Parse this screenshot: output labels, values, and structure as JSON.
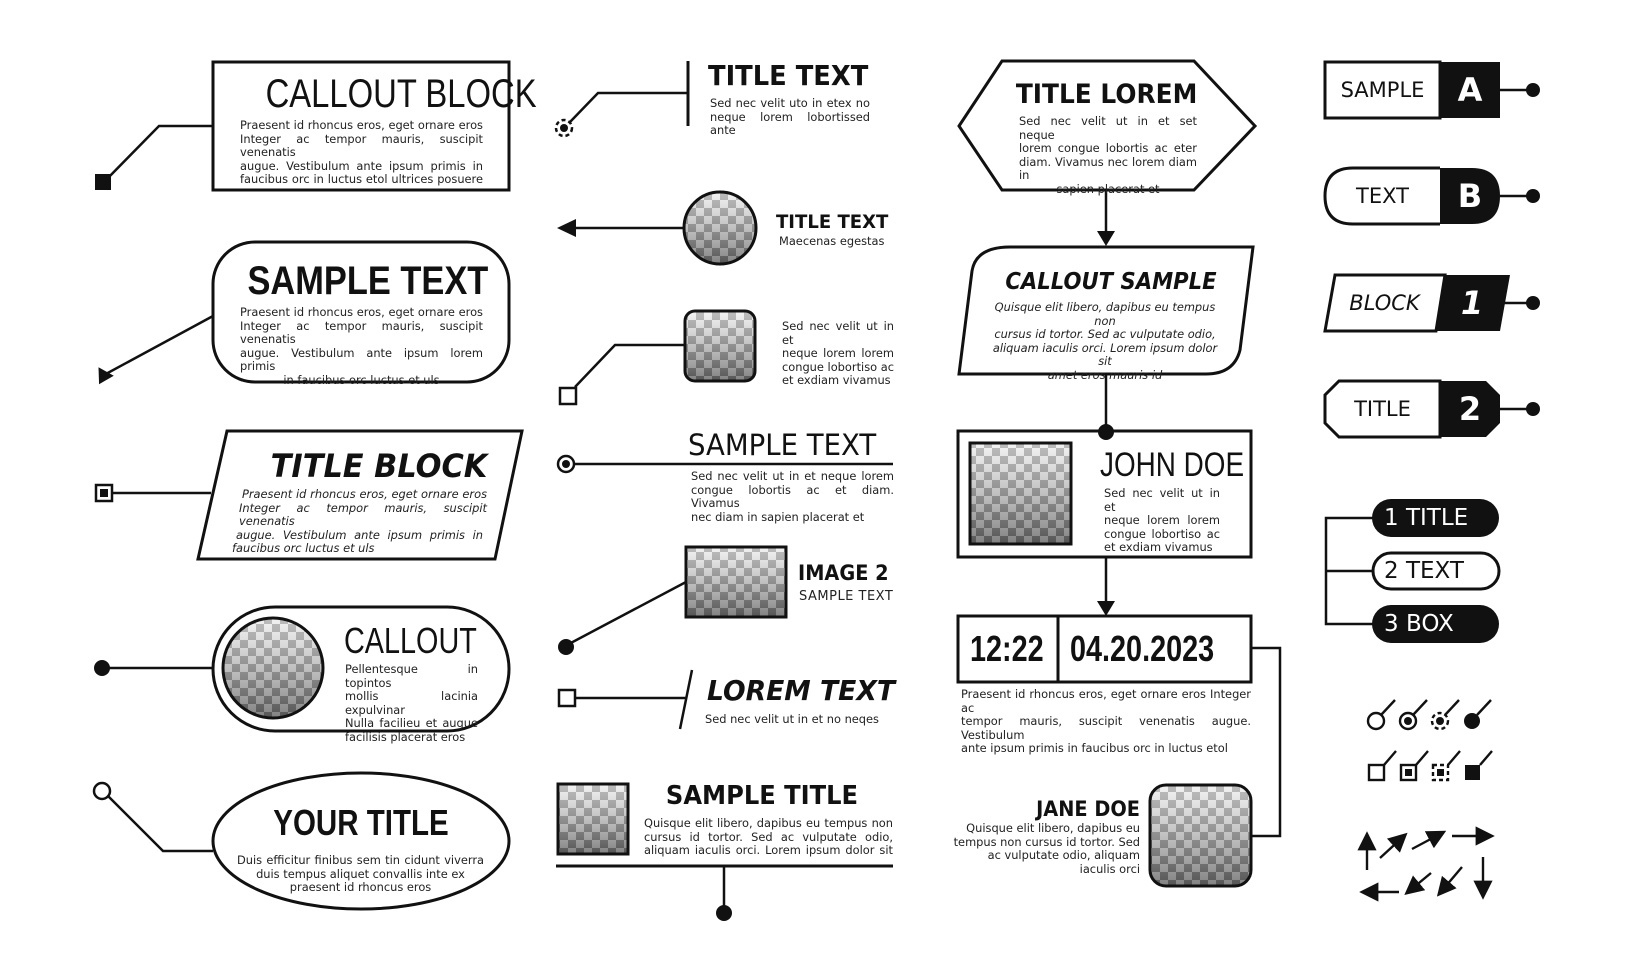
{
  "colors": {
    "ink": "#111111",
    "paper": "#ffffff",
    "checker_dark": "#6e6e6e",
    "checker_light": "#ececec"
  },
  "column1": {
    "callout_block": {
      "title": "CALLOUT BLOCK",
      "lines": [
        "Praesent id rhoncus eros, eget ornare eros",
        "Integer ac tempor mauris, suscipit venenatis",
        "augue. Vestibulum ante ipsum primis in",
        "faucibus orc in luctus etol ultrices posuere"
      ],
      "connector_icon": "filled-square-icon"
    },
    "sample_text": {
      "title": "SAMPLE TEXT",
      "lines": [
        "Praesent id rhoncus eros, eget ornare eros",
        "Integer ac tempor mauris, suscipit venenatis",
        "augue. Vestibulum ante ipsum lorem primis",
        "in faucibus orc luctus et uls"
      ],
      "connector_icon": "filled-triangle-arrow-icon"
    },
    "title_block": {
      "title": "TITLE BLOCK",
      "lines": [
        "Praesent id rhoncus eros, eget ornare eros",
        "Integer ac tempor mauris, suscipit venenatis",
        "augue. Vestibulum ante ipsum primis in",
        "faucibus orc luctus et uls"
      ],
      "connector_icon": "square-dot-icon"
    },
    "callout": {
      "title": "CALLOUT",
      "lines": [
        "Pellentesque in topintos",
        "mollis lacinia expulvinar",
        "Nulla facilieu et augue",
        "facilisis placerat eros"
      ],
      "connector_icon": "filled-circle-icon"
    },
    "your_title": {
      "title": "YOUR TITLE",
      "lines": [
        "Duis efficitur finibus sem tin cidunt viverra",
        "duis tempus aliquet convallis inte ex",
        "praesent id rhoncus eros"
      ],
      "connector_icon": "hollow-circle-icon"
    }
  },
  "column2": {
    "title_text_1": {
      "title": "TITLE TEXT",
      "lines": [
        "Sed nec velit uto in etex no",
        "neque lorem lobortissed ante"
      ],
      "connector_icon": "dashed-circle-dot-icon"
    },
    "title_text_2": {
      "title": "TITLE TEXT",
      "subtitle": "Maecenas egestas",
      "connector_icon": "left-arrow-icon"
    },
    "image_text": {
      "lines": [
        "Sed nec velit ut in et",
        "neque lorem lorem",
        "congue lobortiso ac",
        "et exdiam vivamus"
      ],
      "connector_icon": "hollow-square-icon"
    },
    "sample_text": {
      "title": "SAMPLE TEXT",
      "lines": [
        "Sed nec velit ut in et neque lorem",
        "congue lobortis ac et diam. Vivamus",
        "nec diam in sapien placerat et"
      ],
      "connector_icon": "circle-dot-icon"
    },
    "image_2": {
      "title": "IMAGE 2",
      "subtitle": "SAMPLE TEXT",
      "connector_icon": "filled-circle-icon"
    },
    "lorem_text": {
      "title": "LOREM TEXT",
      "subtitle": "Sed nec velit ut in et no neqes",
      "connector_icon": "hollow-square-icon"
    },
    "sample_title": {
      "title": "SAMPLE TITLE",
      "lines": [
        "Quisque elit libero, dapibus eu tempus non",
        "cursus id tortor. Sed ac vulputate odio,",
        "aliquam iaculis orci. Lorem ipsum dolor sit"
      ],
      "connector_icon": "filled-circle-icon"
    }
  },
  "column3": {
    "title_lorem": {
      "title": "TITLE LOREM",
      "lines": [
        "Sed nec velit ut in et set neque",
        "lorem congue lobortis ac eter",
        "diam. Vivamus nec lorem diam in",
        "sapien placerat et"
      ]
    },
    "callout_sample": {
      "title": "CALLOUT SAMPLE",
      "lines": [
        "Quisque elit libero, dapibus eu tempus non",
        "cursus id tortor. Sed ac vulputate odio,",
        "aliquam iaculis orci. Lorem ipsum dolor sit",
        "amet eros mauris id"
      ]
    },
    "john_doe": {
      "title": "JOHN DOE",
      "lines": [
        "Sed nec velit ut in et",
        "neque lorem lorem",
        "congue lobortiso ac",
        "et exdiam vivamus"
      ]
    },
    "datetime": {
      "time": "12:22",
      "date": "04.20.2023",
      "lines": [
        "Praesent id rhoncus eros, eget ornare eros Integer ac",
        "tempor mauris, suscipit venenatis augue. Vestibulum",
        "ante ipsum primis in faucibus orc in luctus etol"
      ]
    },
    "jane_doe": {
      "title": "JANE DOE",
      "lines": [
        "Quisque elit libero, dapibus eu",
        "tempus non cursus id tortor. Sed",
        "ac vulputate odio, aliquam",
        "iaculis orci"
      ]
    }
  },
  "column4": {
    "tags": [
      {
        "label": "SAMPLE",
        "badge": "A",
        "shape": "rectangle"
      },
      {
        "label": "TEXT",
        "badge": "B",
        "shape": "pill"
      },
      {
        "label": "BLOCK",
        "badge": "1",
        "shape": "slanted"
      },
      {
        "label": "TITLE",
        "badge": "2",
        "shape": "chamfered"
      }
    ],
    "tree": [
      {
        "number": "1",
        "label": "TITLE",
        "style": "filled"
      },
      {
        "number": "2",
        "label": "TEXT",
        "style": "outline"
      },
      {
        "number": "3",
        "label": "BOX",
        "style": "filled"
      }
    ],
    "pointer_icons_row1": [
      "hollow-circle-pointer-icon",
      "circle-dot-pointer-icon",
      "dashed-circle-pointer-icon",
      "filled-circle-pointer-icon"
    ],
    "pointer_icons_row2": [
      "hollow-square-pointer-icon",
      "square-dot-pointer-icon",
      "dashed-square-pointer-icon",
      "filled-square-pointer-icon"
    ],
    "arrow_icons_row1": [
      "arrow-up-icon",
      "arrow-up-right-icon",
      "arrow-up-right-shallow-icon",
      "arrow-right-icon"
    ],
    "arrow_icons_row2": [
      "arrow-left-icon",
      "arrow-down-left-icon",
      "arrow-down-left-steep-icon",
      "arrow-down-icon"
    ]
  }
}
